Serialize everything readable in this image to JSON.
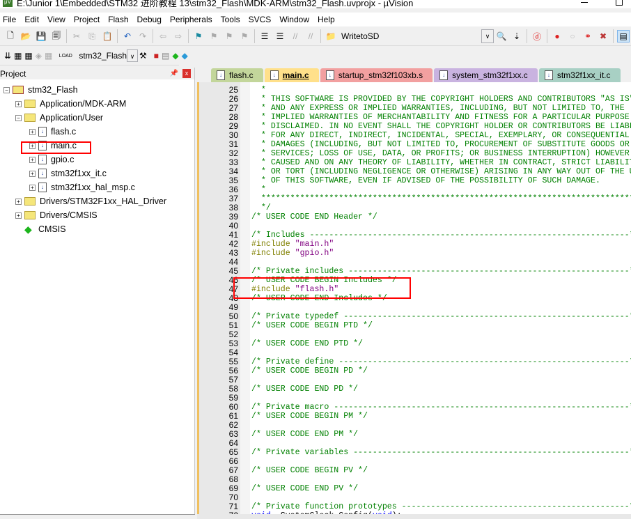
{
  "window": {
    "title": "E:\\Junior 1\\Embedded\\STM32 进阶教程 13\\stm32_Flash\\MDK-ARM\\stm32_Flash.uvprojx - µVision"
  },
  "menu": [
    "File",
    "Edit",
    "View",
    "Project",
    "Flash",
    "Debug",
    "Peripherals",
    "Tools",
    "SVCS",
    "Window",
    "Help"
  ],
  "toolbar": {
    "find_combo": "WritetoSD",
    "target_combo": "stm32_Flash"
  },
  "project": {
    "title": "Project",
    "root": "stm32_Flash",
    "nodes": [
      {
        "label": "Application/MDK-ARM",
        "type": "folder",
        "level": 1,
        "exp": "+"
      },
      {
        "label": "Application/User",
        "type": "folder",
        "level": 1,
        "exp": "-"
      },
      {
        "label": "flash.c",
        "type": "file",
        "level": 2,
        "exp": "+"
      },
      {
        "label": "main.c",
        "type": "file",
        "level": 2,
        "exp": "+"
      },
      {
        "label": "gpio.c",
        "type": "file",
        "level": 2,
        "exp": "+"
      },
      {
        "label": "stm32f1xx_it.c",
        "type": "file",
        "level": 2,
        "exp": "+"
      },
      {
        "label": "stm32f1xx_hal_msp.c",
        "type": "file",
        "level": 2,
        "exp": "+"
      },
      {
        "label": "Drivers/STM32F1xx_HAL_Driver",
        "type": "folder",
        "level": 1,
        "exp": "+"
      },
      {
        "label": "Drivers/CMSIS",
        "type": "folder",
        "level": 1,
        "exp": "+"
      },
      {
        "label": "CMSIS",
        "type": "component",
        "level": 1,
        "exp": ""
      }
    ]
  },
  "tabs": [
    {
      "label": "flash.c",
      "color": "#c3d69b",
      "active": false
    },
    {
      "label": "main.c",
      "color": "#ffe08a",
      "active": true
    },
    {
      "label": "startup_stm32f103xb.s",
      "color": "#f2a0a0",
      "active": false
    },
    {
      "label": "system_stm32f1xx.c",
      "color": "#c9b3e0",
      "active": false
    },
    {
      "label": "stm32f1xx_it.c",
      "color": "#a8d0c4",
      "active": false
    }
  ],
  "colors": {
    "comment": "#008000",
    "preprocessor": "#808000",
    "string": "#800080",
    "keyword": "#0000ff",
    "highlight": "#ff0000"
  },
  "code": [
    {
      "n": "25",
      "seg": [
        [
          "c",
          "  *"
        ]
      ]
    },
    {
      "n": "26",
      "seg": [
        [
          "c",
          "  * THIS SOFTWARE IS PROVIDED BY THE COPYRIGHT HOLDERS AND CONTRIBUTORS \"AS IS\""
        ]
      ]
    },
    {
      "n": "27",
      "seg": [
        [
          "c",
          "  * AND ANY EXPRESS OR IMPLIED WARRANTIES, INCLUDING, BUT NOT LIMITED TO, THE"
        ]
      ]
    },
    {
      "n": "28",
      "seg": [
        [
          "c",
          "  * IMPLIED WARRANTIES OF MERCHANTABILITY AND FITNESS FOR A PARTICULAR PURPOSE"
        ]
      ]
    },
    {
      "n": "29",
      "seg": [
        [
          "c",
          "  * DISCLAIMED. IN NO EVENT SHALL THE COPYRIGHT HOLDER OR CONTRIBUTORS BE LIABLE"
        ]
      ]
    },
    {
      "n": "30",
      "seg": [
        [
          "c",
          "  * FOR ANY DIRECT, INDIRECT, INCIDENTAL, SPECIAL, EXEMPLARY, OR CONSEQUENTIAL"
        ]
      ]
    },
    {
      "n": "31",
      "seg": [
        [
          "c",
          "  * DAMAGES (INCLUDING, BUT NOT LIMITED TO, PROCUREMENT OF SUBSTITUTE GOODS OR"
        ]
      ]
    },
    {
      "n": "32",
      "seg": [
        [
          "c",
          "  * SERVICES; LOSS OF USE, DATA, OR PROFITS; OR BUSINESS INTERRUPTION) HOWEVER"
        ]
      ]
    },
    {
      "n": "33",
      "seg": [
        [
          "c",
          "  * CAUSED AND ON ANY THEORY OF LIABILITY, WHETHER IN CONTRACT, STRICT LIABILITY,"
        ]
      ]
    },
    {
      "n": "34",
      "seg": [
        [
          "c",
          "  * OR TORT (INCLUDING NEGLIGENCE OR OTHERWISE) ARISING IN ANY WAY OUT OF THE USE"
        ]
      ]
    },
    {
      "n": "35",
      "seg": [
        [
          "c",
          "  * OF THIS SOFTWARE, EVEN IF ADVISED OF THE POSSIBILITY OF SUCH DAMAGE."
        ]
      ]
    },
    {
      "n": "36",
      "seg": [
        [
          "c",
          "  *"
        ]
      ]
    },
    {
      "n": "37",
      "seg": [
        [
          "c",
          "  ******************************************************************************"
        ]
      ]
    },
    {
      "n": "38",
      "seg": [
        [
          "c",
          "  */"
        ]
      ]
    },
    {
      "n": "39",
      "seg": [
        [
          "c",
          "/* USER CODE END Header */"
        ]
      ]
    },
    {
      "n": "40",
      "seg": []
    },
    {
      "n": "41",
      "seg": [
        [
          "c",
          "/* Includes ------------------------------------------------------------------*/"
        ]
      ]
    },
    {
      "n": "42",
      "seg": [
        [
          "p",
          "#include "
        ],
        [
          "s",
          "\"main.h\""
        ]
      ]
    },
    {
      "n": "43",
      "seg": [
        [
          "p",
          "#include "
        ],
        [
          "s",
          "\"gpio.h\""
        ]
      ]
    },
    {
      "n": "44",
      "seg": []
    },
    {
      "n": "45",
      "seg": [
        [
          "c",
          "/* Private includes ----------------------------------------------------------*/"
        ]
      ]
    },
    {
      "n": "46",
      "seg": [
        [
          "c",
          "/* USER CODE BEGIN Includes */"
        ]
      ]
    },
    {
      "n": "47",
      "seg": [
        [
          "p",
          "#include "
        ],
        [
          "s",
          "\"flash.h\""
        ]
      ]
    },
    {
      "n": "48",
      "seg": [
        [
          "c",
          "/* USER CODE END Includes */"
        ]
      ]
    },
    {
      "n": "49",
      "seg": []
    },
    {
      "n": "50",
      "seg": [
        [
          "c",
          "/* Private typedef -----------------------------------------------------------*/"
        ]
      ]
    },
    {
      "n": "51",
      "seg": [
        [
          "c",
          "/* USER CODE BEGIN PTD */"
        ]
      ]
    },
    {
      "n": "52",
      "seg": []
    },
    {
      "n": "53",
      "seg": [
        [
          "c",
          "/* USER CODE END PTD */"
        ]
      ]
    },
    {
      "n": "54",
      "seg": []
    },
    {
      "n": "55",
      "seg": [
        [
          "c",
          "/* Private define ------------------------------------------------------------*/"
        ]
      ]
    },
    {
      "n": "56",
      "seg": [
        [
          "c",
          "/* USER CODE BEGIN PD */"
        ]
      ]
    },
    {
      "n": "57",
      "seg": []
    },
    {
      "n": "58",
      "seg": [
        [
          "c",
          "/* USER CODE END PD */"
        ]
      ]
    },
    {
      "n": "59",
      "seg": []
    },
    {
      "n": "60",
      "seg": [
        [
          "c",
          "/* Private macro -------------------------------------------------------------*/"
        ]
      ]
    },
    {
      "n": "61",
      "seg": [
        [
          "c",
          "/* USER CODE BEGIN PM */"
        ]
      ]
    },
    {
      "n": "62",
      "seg": []
    },
    {
      "n": "63",
      "seg": [
        [
          "c",
          "/* USER CODE END PM */"
        ]
      ]
    },
    {
      "n": "64",
      "seg": []
    },
    {
      "n": "65",
      "seg": [
        [
          "c",
          "/* Private variables ---------------------------------------------------------*/"
        ]
      ]
    },
    {
      "n": "66",
      "seg": []
    },
    {
      "n": "67",
      "seg": [
        [
          "c",
          "/* USER CODE BEGIN PV */"
        ]
      ]
    },
    {
      "n": "68",
      "seg": []
    },
    {
      "n": "69",
      "seg": [
        [
          "c",
          "/* USER CODE END PV */"
        ]
      ]
    },
    {
      "n": "70",
      "seg": []
    },
    {
      "n": "71",
      "seg": [
        [
          "c",
          "/* Private function prototypes -----------------------------------------------*/"
        ]
      ]
    },
    {
      "n": "72",
      "seg": [
        [
          "k",
          "void"
        ],
        [
          "",
          "  SystemClock_Config("
        ],
        [
          "k",
          "void"
        ],
        [
          "",
          ");"
        ]
      ]
    }
  ]
}
